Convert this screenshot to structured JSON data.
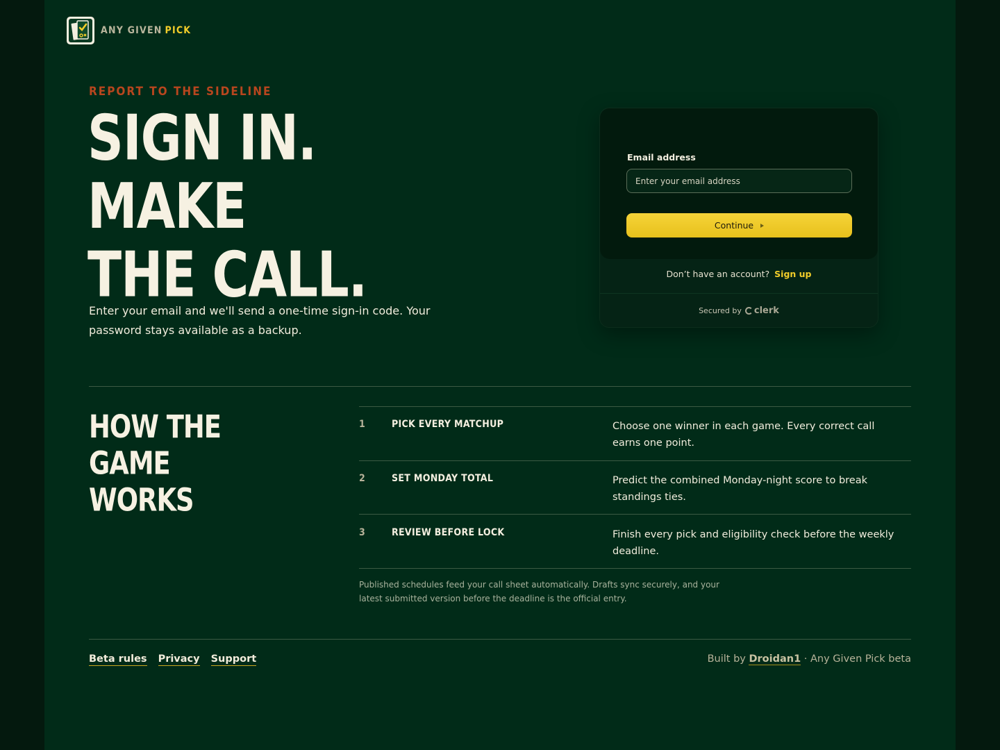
{
  "brand": {
    "name_main": "ANY GIVEN",
    "name_accent": "PICK",
    "logo_icon": "clipboard-check-icon"
  },
  "hero": {
    "eyebrow": "REPORT TO THE SIDELINE",
    "title_lines": [
      "SIGN IN.",
      "MAKE",
      "THE CALL."
    ],
    "description": "Enter your email and we'll send a one-time sign-in code. Your password stays available as a backup."
  },
  "signin": {
    "email_label": "Email address",
    "email_placeholder": "Enter your email address",
    "email_value": "",
    "continue_label": "Continue",
    "no_account_text": "Don’t have an account?",
    "signup_label": "Sign up",
    "secured_by": "Secured by",
    "provider": "clerk"
  },
  "how": {
    "title_lines": [
      "HOW THE",
      "GAME",
      "WORKS"
    ],
    "steps": [
      {
        "num": "1",
        "title": "PICK EVERY MATCHUP",
        "desc": "Choose one winner in each game. Every correct call earns one point."
      },
      {
        "num": "2",
        "title": "SET MONDAY TOTAL",
        "desc": "Predict the combined Monday-night score to break standings ties."
      },
      {
        "num": "3",
        "title": "REVIEW BEFORE LOCK",
        "desc": "Finish every pick and eligibility check before the weekly deadline."
      }
    ],
    "footnote": "Published schedules feed your call sheet automatically. Drafts sync securely, and your latest submitted version before the deadline is the official entry."
  },
  "footer": {
    "links": [
      "Beta rules",
      "Privacy",
      "Support"
    ],
    "built_by_prefix": "Built by",
    "author": "Droidan1",
    "suffix": "· Any Given Pick beta"
  },
  "colors": {
    "background": "#012b18",
    "accent_yellow": "#f2cd2a",
    "eyebrow_red": "#b8461e",
    "cream": "#f6f1e2"
  }
}
